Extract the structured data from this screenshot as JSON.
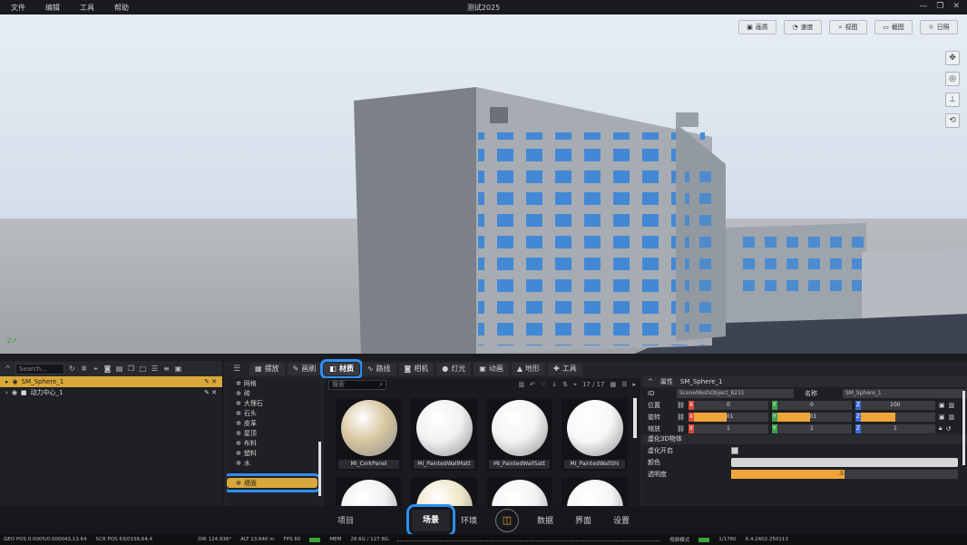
{
  "menu": [
    "文件",
    "编辑",
    "工具",
    "帮助"
  ],
  "window_title": "测试2025",
  "window_controls": [
    "—",
    "❐",
    "✕"
  ],
  "viewport_toolbar": [
    {
      "icon": "image-icon",
      "glyph": "▣",
      "label": "画质"
    },
    {
      "icon": "speed-icon",
      "glyph": "◔",
      "label": "速度"
    },
    {
      "icon": "search-icon",
      "glyph": "⌕",
      "label": "视图"
    },
    {
      "icon": "screenshot-icon",
      "glyph": "▭",
      "label": "截图"
    },
    {
      "icon": "sun-icon",
      "glyph": "☼",
      "label": "日照"
    }
  ],
  "viewport_side": [
    {
      "icon": "move-icon",
      "glyph": "✥"
    },
    {
      "icon": "orbit-icon",
      "glyph": "◎"
    },
    {
      "icon": "axis-icon",
      "glyph": "⊥"
    },
    {
      "icon": "rotate-icon",
      "glyph": "⟲"
    }
  ],
  "axis": "Z",
  "outliner": {
    "search_placeholder": "Search...",
    "rows": [
      {
        "label": "SM_Sphere_1",
        "selected": true
      },
      {
        "label": "动力中心_1",
        "selected": false
      }
    ]
  },
  "tabs": [
    {
      "icon": "grid-icon",
      "label": "摆放",
      "active": false
    },
    {
      "icon": "paint-icon",
      "label": "画刷",
      "active": false
    },
    {
      "icon": "material-icon",
      "label": "材质",
      "active": true
    },
    {
      "icon": "path-icon",
      "label": "路线",
      "active": false
    },
    {
      "icon": "camera-icon",
      "label": "相机",
      "active": false
    },
    {
      "icon": "light-icon",
      "label": "灯光",
      "active": false
    },
    {
      "icon": "animation-icon",
      "label": "动画",
      "active": false
    },
    {
      "icon": "terrain-icon",
      "label": "地形",
      "active": false
    },
    {
      "icon": "tool-icon",
      "label": "工具",
      "active": false
    }
  ],
  "categories": [
    {
      "label": "网格",
      "active": false
    },
    {
      "label": "砖",
      "active": false
    },
    {
      "label": "大理石",
      "active": false
    },
    {
      "label": "石头",
      "active": false
    },
    {
      "label": "皮革",
      "active": false
    },
    {
      "label": "屋顶",
      "active": false
    },
    {
      "label": "布料",
      "active": false
    },
    {
      "label": "塑料",
      "active": false
    },
    {
      "label": "水",
      "active": false
    },
    {
      "label": "墙面",
      "active": true
    }
  ],
  "materials": {
    "search_placeholder": "搜索",
    "count": "17 / 17",
    "items": [
      {
        "label": "MI_CorkPanel",
        "color": "#d8c6a0"
      },
      {
        "label": "MI_PaintedWallMatt",
        "color": "#f2f2f2"
      },
      {
        "label": "MI_PaintedWallSatt",
        "color": "#f4f4f4"
      },
      {
        "label": "MI_PaintedWallShi",
        "color": "#f7f7f7"
      },
      {
        "label": "",
        "color": "#f0f0f0"
      },
      {
        "label": "",
        "color": "#efe7c8"
      },
      {
        "label": "",
        "color": "#f3f3f3"
      },
      {
        "label": "",
        "color": "#f5f5f5"
      }
    ]
  },
  "properties": {
    "header": "属性",
    "object_name": "SM_Sphere_1",
    "id_label": "ID",
    "id_value": "SceneMeshObject_8231",
    "name_label": "名称",
    "name_value": "SM_Sphere_1",
    "position": {
      "label": "位置",
      "x": "0",
      "y": "0",
      "z": "100"
    },
    "rotation": {
      "label": "旋转",
      "x": ".01",
      "y": ".01",
      "z": ""
    },
    "scale": {
      "label": "缩放",
      "x": "1",
      "y": "1",
      "z": "1"
    },
    "virtual_section": "虚化3D物体",
    "virtual_on": "虚化开启",
    "color_label": "颜色",
    "opacity_label": "透明度",
    "opacity_value": ".5",
    "opacity_fraction": 0.5
  },
  "mainnav": [
    {
      "label": "项目",
      "active": false
    },
    {
      "label": "场景",
      "active": true
    },
    {
      "label": "环境",
      "active": false
    },
    {
      "label": "数据",
      "active": false
    },
    {
      "label": "界面",
      "active": false
    },
    {
      "label": "设置",
      "active": false
    }
  ],
  "status": {
    "geo": "GEO POS  0.0005/0.000043,13.64",
    "scr": "SCR POS  63/0156,64,4",
    "dir": "DIR  124.936°",
    "alt": "ALT  13.640 m",
    "fps": "FPS  60",
    "mem": "MEM",
    "mem_val": "28.6G / 127.8G",
    "mode": "视频模式",
    "frame": "1/1760",
    "ver": "6.4.2402.250113"
  }
}
